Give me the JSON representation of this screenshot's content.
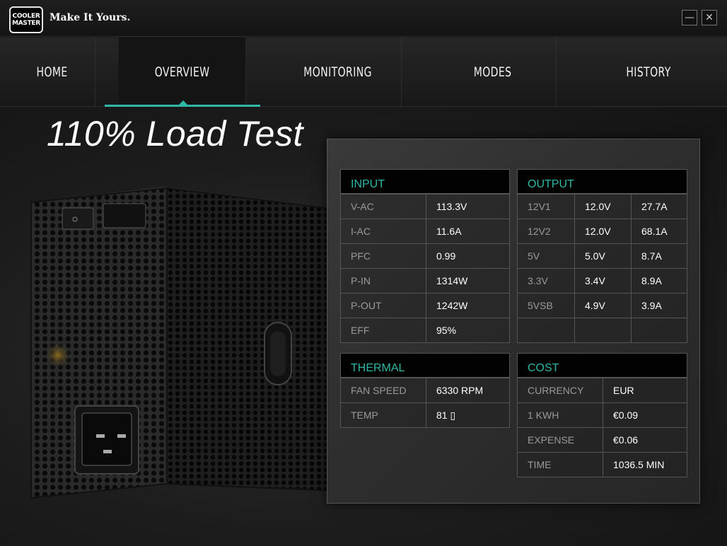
{
  "app": {
    "brand_logo": [
      "COOLER",
      "MASTER"
    ],
    "tagline": "Make It Yours.",
    "window_controls": {
      "minimize_icon": "minimize-icon",
      "close_icon": "close-icon"
    }
  },
  "nav": {
    "tabs": [
      {
        "label": "HOME",
        "active": false
      },
      {
        "label": "OVERVIEW",
        "active": true
      },
      {
        "label": "MONITORING",
        "active": false
      },
      {
        "label": "MODES",
        "active": false
      },
      {
        "label": "HISTORY",
        "active": false
      }
    ],
    "accent_color": "#2fb8a6"
  },
  "main": {
    "heading": "110% Load Test"
  },
  "input": {
    "title": "INPUT",
    "rows": [
      {
        "label": "V-AC",
        "value": "113.3V"
      },
      {
        "label": "I-AC",
        "value": "11.6A"
      },
      {
        "label": "PFC",
        "value": "0.99"
      },
      {
        "label": "P-IN",
        "value": "1314W"
      },
      {
        "label": "P-OUT",
        "value": "1242W"
      },
      {
        "label": "EFF",
        "value": "95%"
      }
    ]
  },
  "output": {
    "title": "OUTPUT",
    "rows": [
      {
        "rail": "12V1",
        "volt": "12.0V",
        "amp": "27.7A"
      },
      {
        "rail": "12V2",
        "volt": "12.0V",
        "amp": "68.1A"
      },
      {
        "rail": "5V",
        "volt": "5.0V",
        "amp": "8.7A"
      },
      {
        "rail": "3.3V",
        "volt": "3.4V",
        "amp": "8.9A"
      },
      {
        "rail": "5VSB",
        "volt": "4.9V",
        "amp": "3.9A"
      },
      {
        "rail": "",
        "volt": "",
        "amp": ""
      }
    ]
  },
  "thermal": {
    "title": "THERMAL",
    "rows": [
      {
        "label": "FAN SPEED",
        "value": "6330 RPM"
      },
      {
        "label": "TEMP",
        "value": "81 ▯"
      }
    ]
  },
  "cost": {
    "title": "COST",
    "rows": [
      {
        "label": "CURRENCY",
        "value": "EUR"
      },
      {
        "label": "1 KWH",
        "value": "€0.09"
      },
      {
        "label": "EXPENSE",
        "value": "€0.06"
      },
      {
        "label": "TIME",
        "value": "1036.5 MIN"
      }
    ]
  }
}
